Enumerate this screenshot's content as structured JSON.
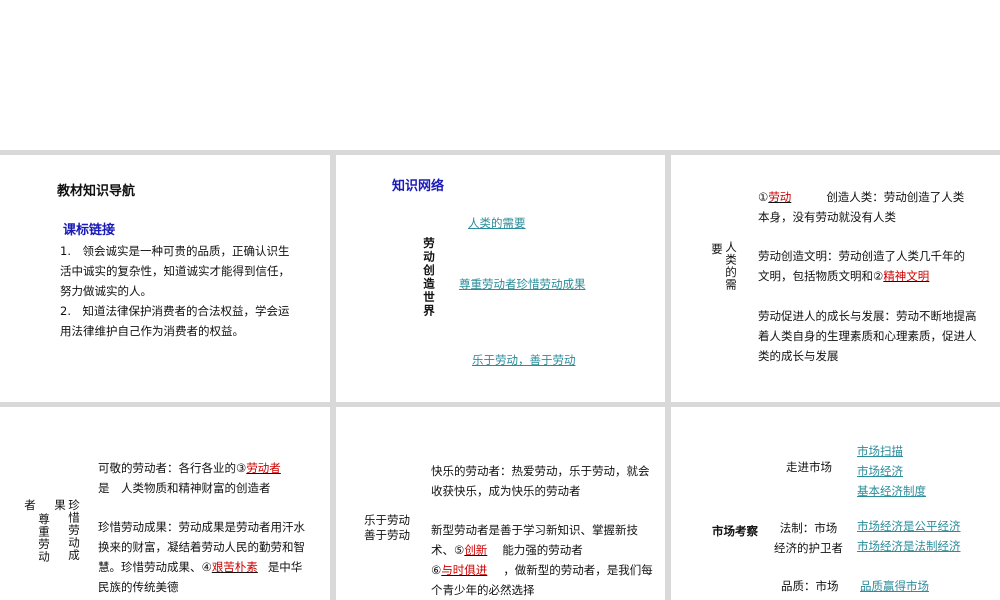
{
  "p1": {
    "title": "教材知识导航",
    "subtitle": "课标链接",
    "item1": "1.　领会诚实是一种可贵的品质，正确认识生活中诚实的复杂性，知道诚实才能得到信任，努力做诚实的人。",
    "item2": "2.　知道法律保护消费者的合法权益，学会运用法律维护自己作为消费者的权益。"
  },
  "p2": {
    "title": "知识网络",
    "vertical": "劳动创造世界",
    "links": [
      "人类的需要",
      "尊重劳动者珍惜劳动成果",
      "乐于劳动，善于劳动"
    ]
  },
  "p3": {
    "vertical_outer": "要",
    "vertical_inner": "人类的需",
    "para1_prefix": "①",
    "para1_answer": "劳动",
    "para1_rest": "创造人类：劳动创造了人类本身，没有劳动就没有人类",
    "para2_text": "劳动创造文明：劳动创造了人类几千年的文明，包括物质文明和②",
    "para2_answer": "精神文明",
    "para3_text": "劳动促进人的成长与发展：劳动不断地提高着人类自身的生理素质和心理素质，促进人类的成长与发展"
  },
  "p4": {
    "vertical_a": "者",
    "vertical_b": "尊重劳动",
    "vertical_c": "果",
    "vertical_d": "珍惜劳动成",
    "line1_text": "可敬的劳动者：各行各业的③",
    "line1_answer": "劳动者",
    "line2_text": "是　人类物质和精神财富的创造者",
    "para2_text": "珍惜劳动成果：劳动成果是劳动者用汗水换来的财富，凝结着劳动人民的勤劳和智慧。珍惜劳动成果、④",
    "para2_answer": "艰苦朴素",
    "para2_rest": "是中华民族的传统美德"
  },
  "p5": {
    "left_label_1": "乐于劳动",
    "left_label_2": "善于劳动",
    "para1": "快乐的劳动者：热爱劳动，乐于劳动，就会收获快乐，成为快乐的劳动者",
    "para2_text": "新型劳动者是善于学习新知识、掌握新技术、⑤",
    "para2_answer": "创新",
    "para2_rest": "能力强的劳动者",
    "para3_prefix": "⑥",
    "para3_answer": "与时俱进",
    "para3_rest": "，做新型的劳动者，是我们每个青少年的必然选择"
  },
  "p6": {
    "main_label": "市场考察",
    "group1_label": "走进市场",
    "group1_links": [
      "市场扫描",
      "市场经济",
      "基本经济制度"
    ],
    "group2_label_1": "法制：市场",
    "group2_label_2": "经济的护卫者",
    "group2_links": [
      "市场经济是公平经济",
      "市场经济是法制经济"
    ],
    "group3_label": "品质：市场",
    "group3_links": [
      "品质赢得市场"
    ]
  }
}
